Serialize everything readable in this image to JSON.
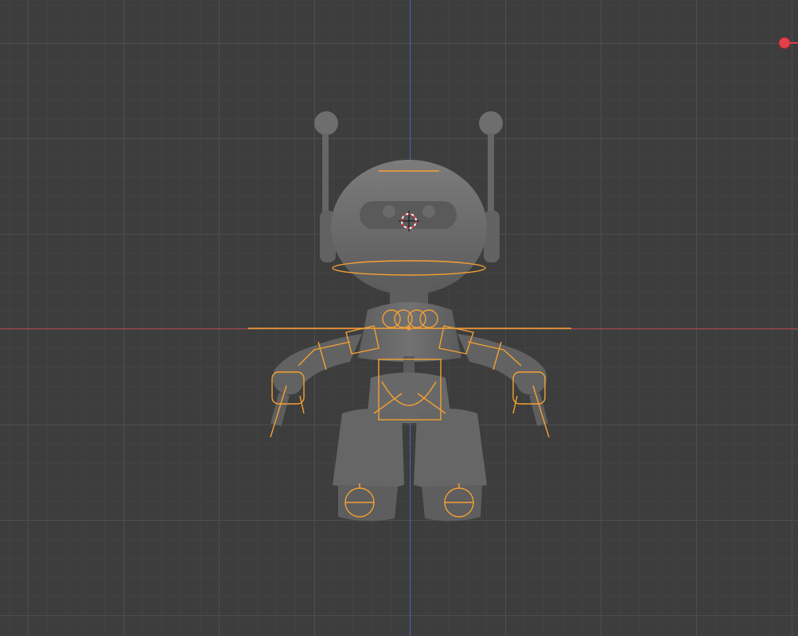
{
  "viewport": {
    "background_color": "#3d3d3d",
    "grid_color": "#505050",
    "x_axis_color": "#a9414f",
    "y_axis_color": "#4b6aa6"
  },
  "model": {
    "body_color": "#6a6a6a",
    "armature_color": "#f5a033",
    "cursor_colors": [
      "#e0404a",
      "#ffffff"
    ]
  },
  "gizmo": {
    "x_axis_color": "#e0404a",
    "icon": "navigation-gizmo-x-icon"
  }
}
